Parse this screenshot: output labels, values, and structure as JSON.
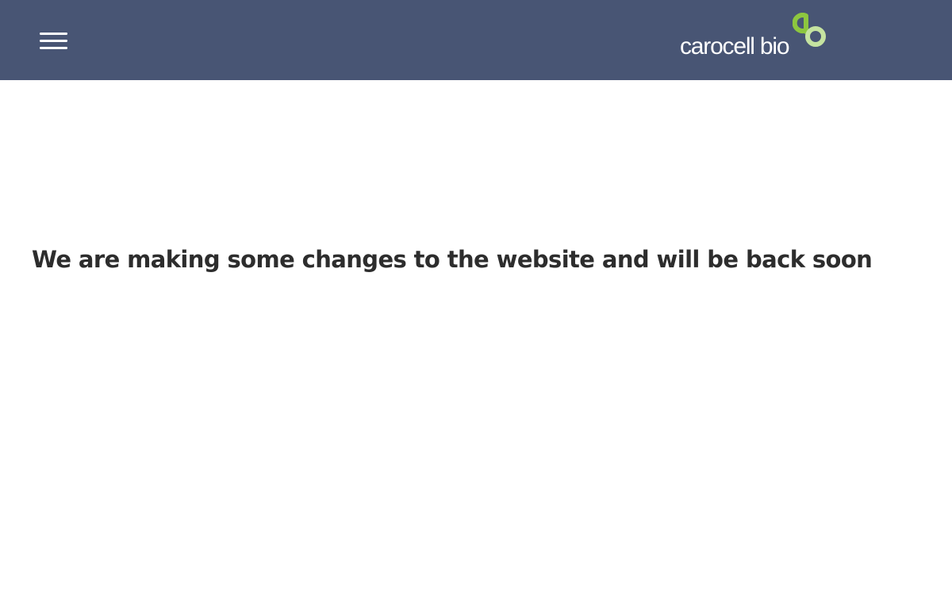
{
  "header": {
    "menu_icon": "hamburger-menu-icon",
    "logo": {
      "text": "carocell bio",
      "mark_icon": "carocell-bio-logo-mark-icon",
      "colors": {
        "text": "#ffffff",
        "mark_top": "#8dc63f",
        "mark_bottom": "#c5e3a0"
      }
    },
    "background_color": "#485574"
  },
  "main": {
    "message": "We are making some changes to the website and will be back soon",
    "text_color": "#2d2d2d"
  }
}
